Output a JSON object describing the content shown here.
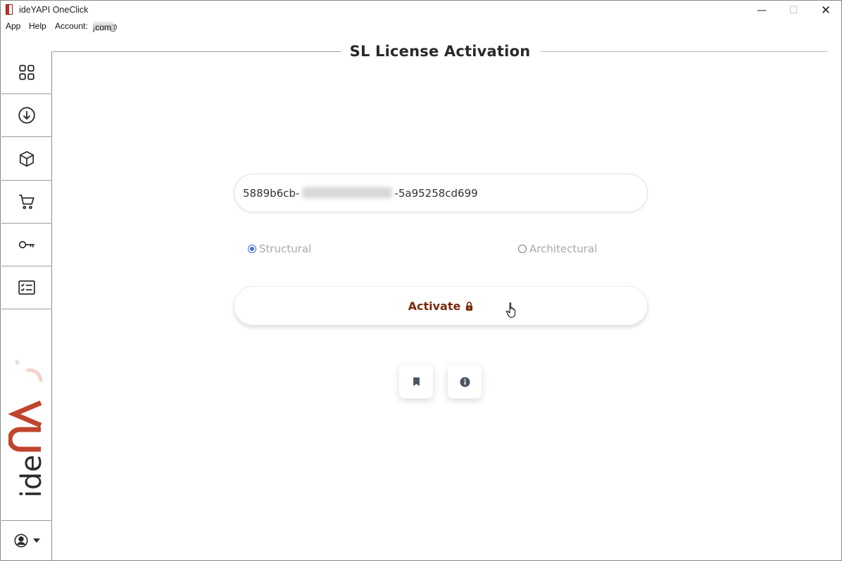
{
  "window": {
    "title": "ideYAPI OneClick",
    "minimize_glyph": "—",
    "maximize_glyph": "☐",
    "close_glyph": "✕"
  },
  "menu": {
    "app": "App",
    "help": "Help",
    "account_label": "Account:",
    "account_prefix": "john@",
    "account_suffix": ".com"
  },
  "sidebar": {
    "items": [
      {
        "icon": "grid-icon"
      },
      {
        "icon": "download-icon"
      },
      {
        "icon": "cube-icon"
      },
      {
        "icon": "cart-icon"
      },
      {
        "icon": "key-icon"
      },
      {
        "icon": "checklist-icon"
      }
    ],
    "brand_text": "ideCAD",
    "bottom_icon": "user-circle-icon"
  },
  "main": {
    "title": "SL License Activation",
    "license_key_start": "5889b6cb-",
    "license_key_end": "-5a95258cd699",
    "options": [
      {
        "label": "Structural",
        "checked": true
      },
      {
        "label": "Architectural",
        "checked": false
      }
    ],
    "activate_label": "Activate",
    "activate_icon": "lock-icon",
    "buttons": [
      {
        "icon": "bookmark-icon"
      },
      {
        "icon": "info-icon"
      }
    ]
  },
  "colors": {
    "accent": "#7a2a0e",
    "brand_red": "#c0442e",
    "radio_blue": "#3b6fd6",
    "icon_dark": "#2b2b2b",
    "muted_text": "#a8a8ac"
  }
}
